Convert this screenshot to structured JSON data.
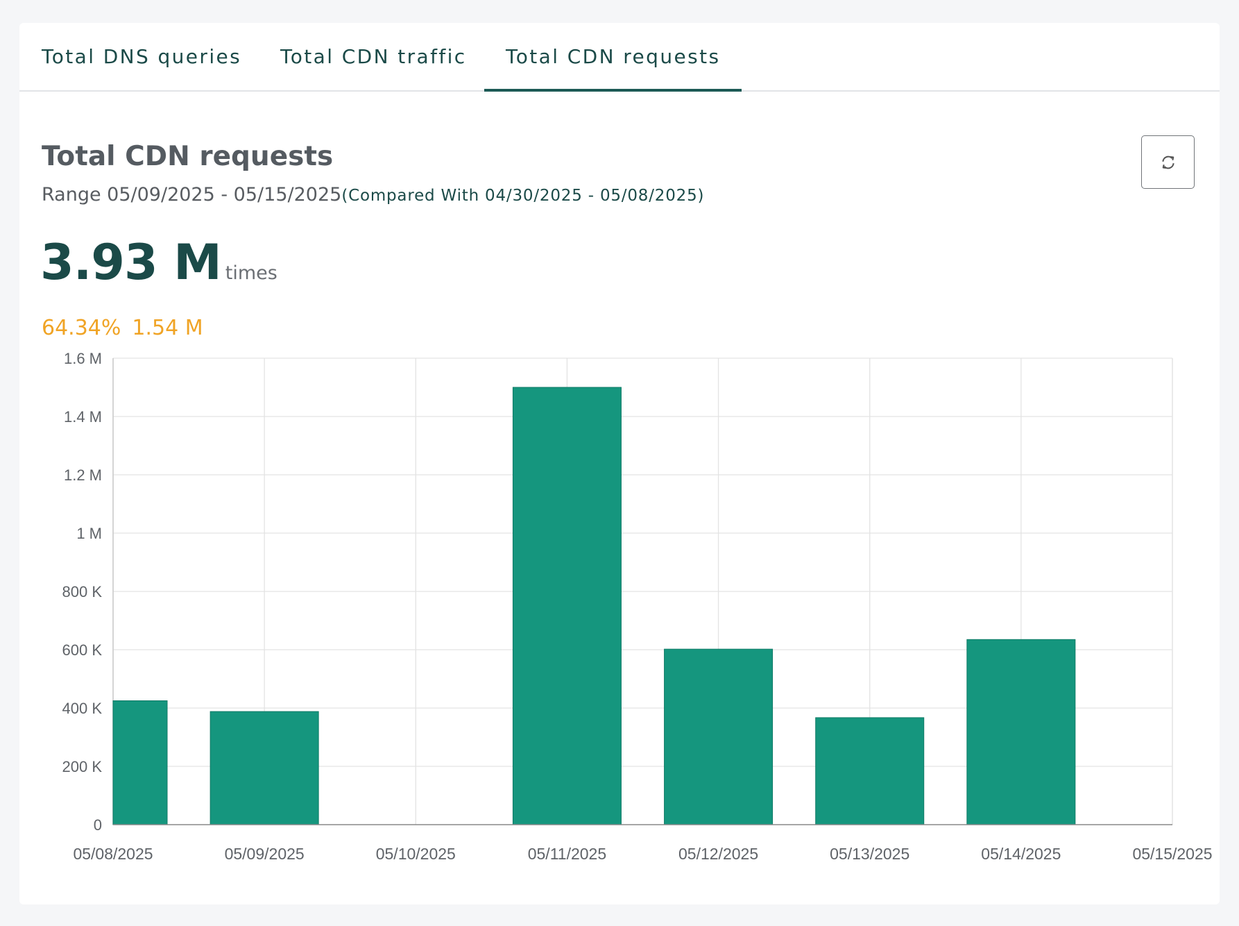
{
  "tabs": [
    {
      "label": "Total DNS queries",
      "active": false
    },
    {
      "label": "Total CDN traffic",
      "active": false
    },
    {
      "label": "Total CDN requests",
      "active": true
    }
  ],
  "panel": {
    "title": "Total CDN requests",
    "range": "Range 05/09/2025 - 05/15/2025",
    "compare": "(Compared With 04/30/2025 - 05/08/2025)",
    "total_value": "3.93 M",
    "total_unit": "times",
    "change_percent": "64.34%",
    "change_value": "1.54 M",
    "refresh_icon": "refresh-icon"
  },
  "colors": {
    "bar": "#15967e",
    "accent": "#1b4a48",
    "change": "#f0a426"
  },
  "chart_data": {
    "type": "bar",
    "categories": [
      "05/08/2025",
      "05/09/2025",
      "05/10/2025",
      "05/11/2025",
      "05/12/2025",
      "05/13/2025",
      "05/14/2025",
      "05/15/2025"
    ],
    "values": [
      425000,
      388000,
      0,
      1500000,
      602000,
      367000,
      635000,
      0
    ],
    "ylim": [
      0,
      1600000
    ],
    "yticks": [
      "0",
      "200 K",
      "400 K",
      "600 K",
      "800 K",
      "1 M",
      "1.2 M",
      "1.4 M",
      "1.6 M"
    ],
    "xlabel": "",
    "ylabel": "",
    "grid": true,
    "legend": "none"
  }
}
